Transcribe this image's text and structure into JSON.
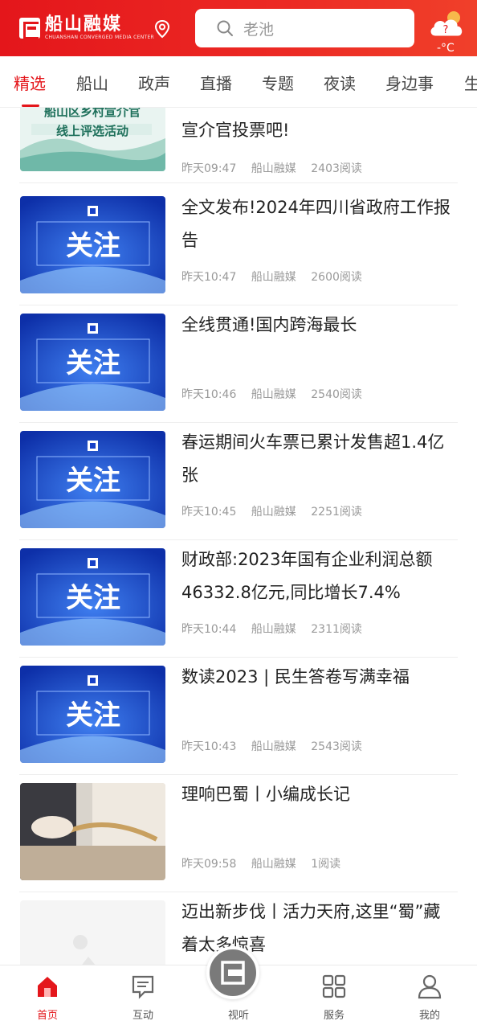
{
  "header": {
    "logo_cn": "船山融媒",
    "logo_en": "CHUANSHAN CONVERGED MEDIA CENTER",
    "search_placeholder": "老池",
    "weather_temp": "-°C"
  },
  "tabs": [
    {
      "label": "精选",
      "active": true
    },
    {
      "label": "船山"
    },
    {
      "label": "政声"
    },
    {
      "label": "直播"
    },
    {
      "label": "专题"
    },
    {
      "label": "夜读"
    },
    {
      "label": "身边事"
    },
    {
      "label": "生"
    }
  ],
  "thumb_text": {
    "focus": "关注",
    "event_line1": "船山区乡村宣介官",
    "event_line2": "线上评选活动"
  },
  "articles": [
    {
      "title": "宣介官投票吧!",
      "time": "昨天09:47",
      "source": "船山融媒",
      "reads": "2403阅读",
      "thumb": "event"
    },
    {
      "title": "全文发布!2024年四川省政府工作报告",
      "time": "昨天10:47",
      "source": "船山融媒",
      "reads": "2600阅读",
      "thumb": "focus"
    },
    {
      "title": "全线贯通!国内跨海最长",
      "time": "昨天10:46",
      "source": "船山融媒",
      "reads": "2540阅读",
      "thumb": "focus"
    },
    {
      "title": "春运期间火车票已累计发售超1.4亿张",
      "time": "昨天10:45",
      "source": "船山融媒",
      "reads": "2251阅读",
      "thumb": "focus"
    },
    {
      "title": "财政部:2023年国有企业利润总额46332.8亿元,同比增长7.4%",
      "time": "昨天10:44",
      "source": "船山融媒",
      "reads": "2311阅读",
      "thumb": "focus"
    },
    {
      "title": "数读2023 | 民生答卷写满幸福",
      "time": "昨天10:43",
      "source": "船山融媒",
      "reads": "2543阅读",
      "thumb": "focus"
    },
    {
      "title": "理响巴蜀丨小编成长记",
      "time": "昨天09:58",
      "source": "船山融媒",
      "reads": "1阅读",
      "thumb": "photo"
    },
    {
      "title": "迈出新步伐丨活力天府,这里“蜀”藏着太多惊喜",
      "time": "",
      "source": "",
      "reads": "",
      "thumb": "placeholder"
    }
  ],
  "bottom_nav": [
    {
      "label": "首页",
      "icon": "home-icon",
      "active": true
    },
    {
      "label": "互动",
      "icon": "chat-icon"
    },
    {
      "label": "视听",
      "icon": "media-icon"
    },
    {
      "label": "服务",
      "icon": "grid-icon"
    },
    {
      "label": "我的",
      "icon": "user-icon"
    }
  ],
  "colors": {
    "brand": "#e4161b",
    "focus_blue": "#1741c8"
  }
}
